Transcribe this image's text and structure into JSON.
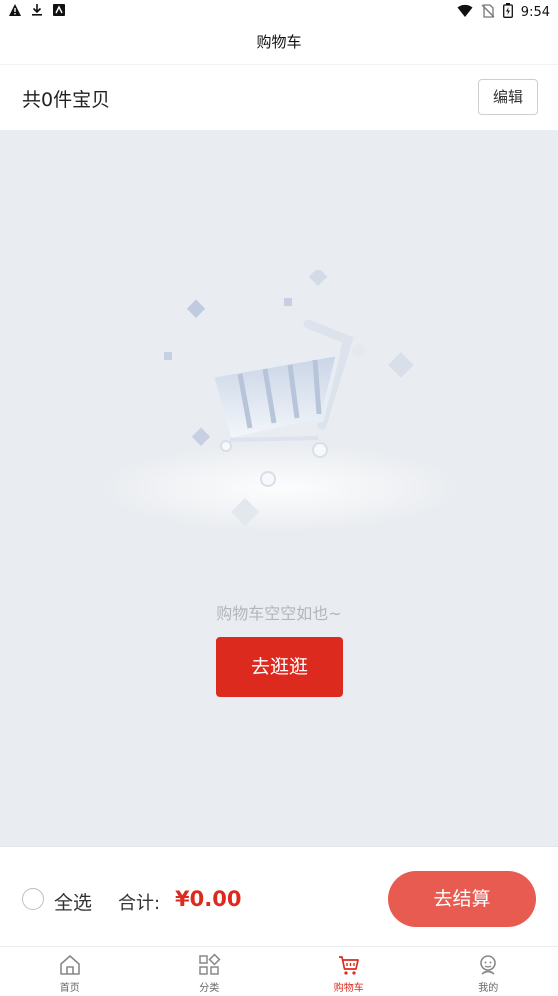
{
  "status_bar": {
    "time": "9:54"
  },
  "title": "购物车",
  "header": {
    "count_text": "共0件宝贝",
    "edit_label": "编辑"
  },
  "empty_state": {
    "message": "购物车空空如也~",
    "button_label": "去逛逛"
  },
  "checkout": {
    "select_all_label": "全选",
    "total_label": "合计:",
    "total_value": "¥0.00",
    "checkout_label": "去结算"
  },
  "tabs": [
    {
      "label": "首页",
      "icon": "home-icon"
    },
    {
      "label": "分类",
      "icon": "category-icon"
    },
    {
      "label": "购物车",
      "icon": "cart-icon",
      "active": true
    },
    {
      "label": "我的",
      "icon": "profile-icon"
    }
  ],
  "colors": {
    "accent": "#dd2a1f",
    "checkout": "#e85b51",
    "empty_bg": "#e9ecf0"
  }
}
